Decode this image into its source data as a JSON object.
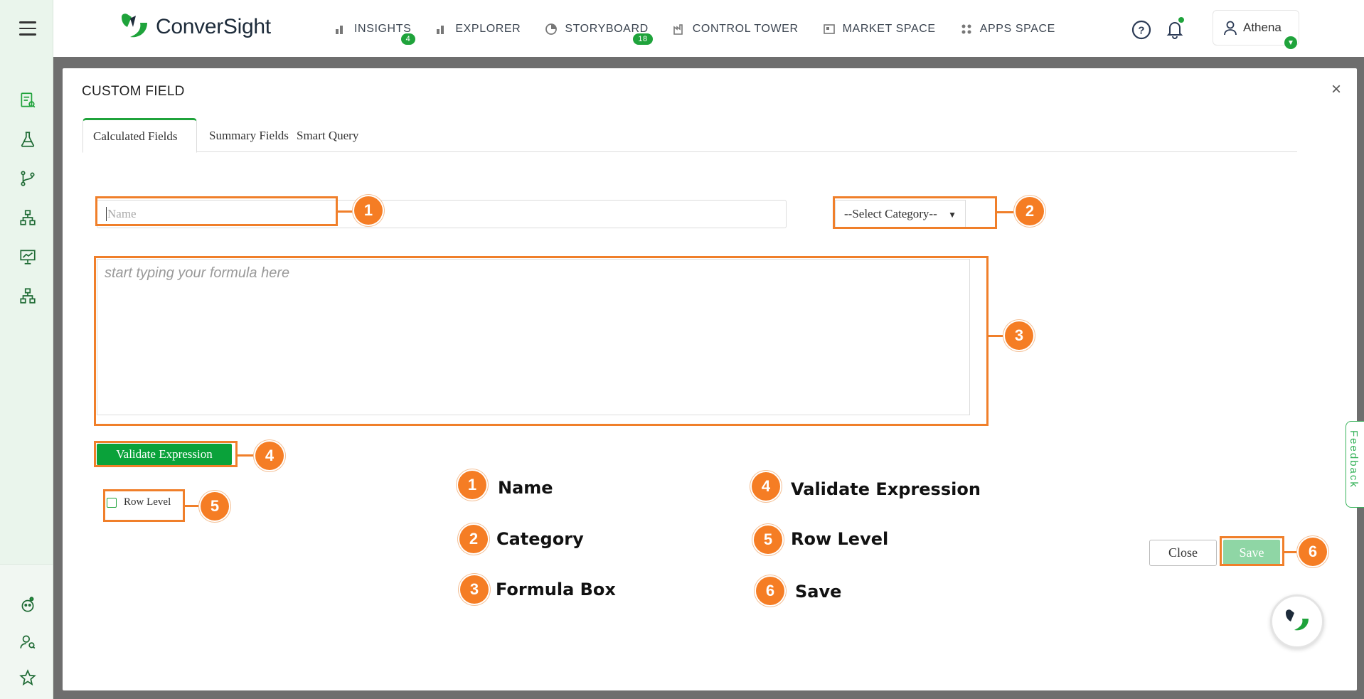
{
  "app": {
    "brand": "ConverSight"
  },
  "nav": {
    "items": [
      {
        "label": "INSIGHTS",
        "badge": "4"
      },
      {
        "label": "EXPLORER",
        "badge": ""
      },
      {
        "label": "STORYBOARD",
        "badge": "18"
      },
      {
        "label": "CONTROL TOWER",
        "badge": ""
      },
      {
        "label": "MARKET SPACE",
        "badge": ""
      },
      {
        "label": "APPS SPACE",
        "badge": ""
      }
    ]
  },
  "user": {
    "name": "Athena"
  },
  "modal": {
    "title": "CUSTOM FIELD",
    "close_symbol": "×",
    "tabs": [
      {
        "label": "Calculated Fields",
        "active": true
      },
      {
        "label": "Summary Fields",
        "active": false
      },
      {
        "label": "Smart Query",
        "active": false
      }
    ],
    "name_placeholder": "Name",
    "category_placeholder": "--Select Category--",
    "formula_placeholder": "start typing your formula here",
    "validate_label": "Validate Expression",
    "row_level_label": "Row Level",
    "close_label": "Close",
    "save_label": "Save"
  },
  "annotations": [
    {
      "num": "1",
      "label": "Name"
    },
    {
      "num": "2",
      "label": "Category"
    },
    {
      "num": "3",
      "label": "Formula Box"
    },
    {
      "num": "4",
      "label": "Validate Expression"
    },
    {
      "num": "5",
      "label": "Row Level"
    },
    {
      "num": "6",
      "label": "Save"
    }
  ],
  "feedback_label": "Feedback",
  "colors": {
    "brand_green": "#1fa33b",
    "annotation_orange": "#f57d24",
    "save_disabled": "#8fd6a5"
  }
}
